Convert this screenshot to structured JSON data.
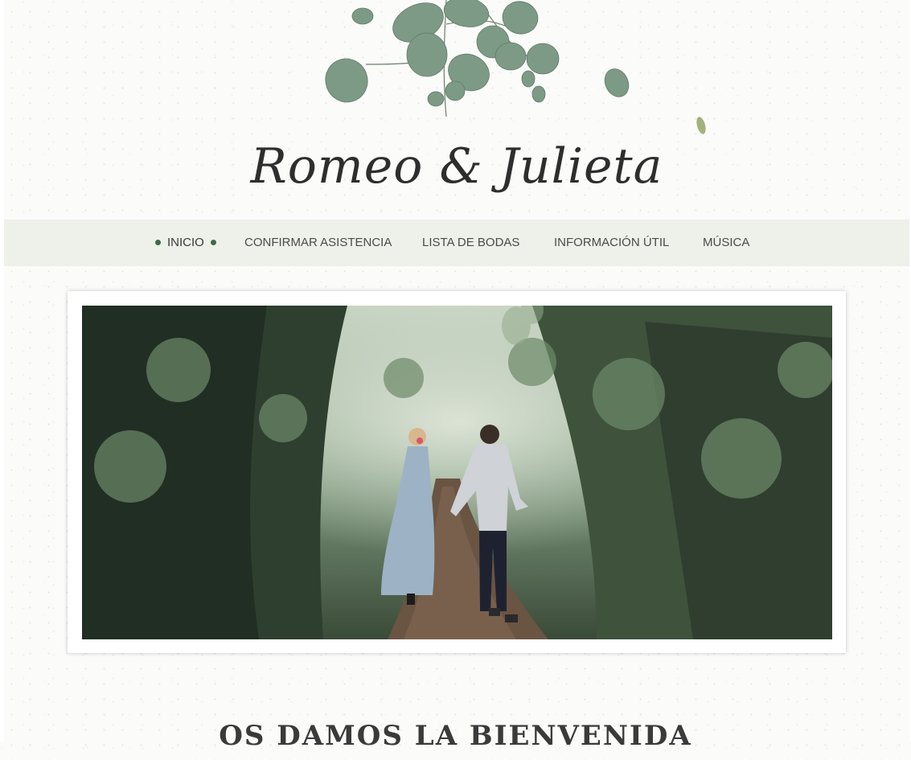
{
  "site": {
    "title": "Romeo & Julieta"
  },
  "nav": {
    "items": [
      {
        "label": "INICIO",
        "active": true
      },
      {
        "label": "CONFIRMAR ASISTENCIA",
        "active": false
      },
      {
        "label": "LISTA DE BODAS",
        "active": false
      },
      {
        "label": "INFORMACIÓN ÚTIL",
        "active": false
      },
      {
        "label": "MÚSICA",
        "active": false
      }
    ]
  },
  "hero": {
    "image": "couple walking hand in hand on a forest path"
  },
  "welcome": {
    "heading": "OS DAMOS LA BIENVENIDA"
  },
  "colors": {
    "nav_background": "#eef0ea",
    "accent_dot": "#3f6b4a",
    "text": "#3a3a3a",
    "leaf_green": "#6f8f78"
  },
  "icons": [
    "eucalyptus-leaves-decoration",
    "active-dot-icon"
  ]
}
